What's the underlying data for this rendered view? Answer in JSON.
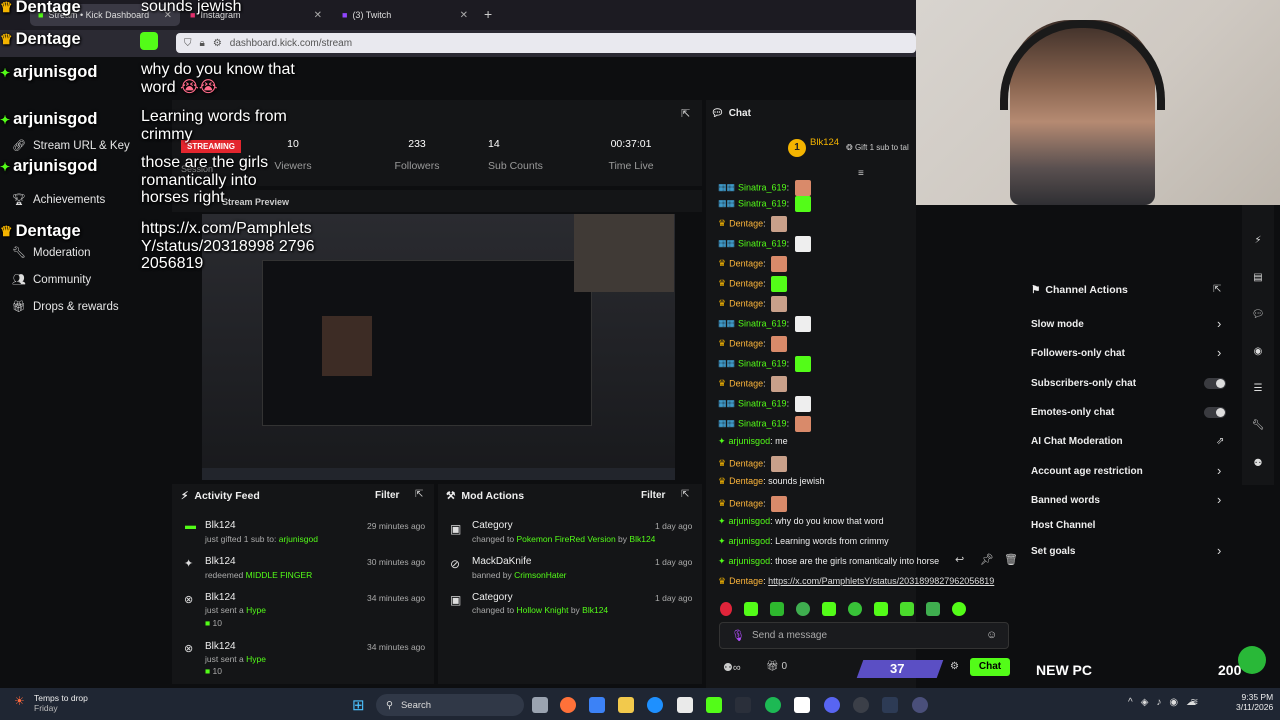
{
  "browser": {
    "tabs": [
      {
        "label": "Stream • Kick Dashboard"
      },
      {
        "label": "Instagram"
      },
      {
        "label": "(3) Twitch"
      }
    ],
    "url": "dashboard.kick.com/stream"
  },
  "sidebar": {
    "items": [
      {
        "label": "Stream URL & Key",
        "icon": "link-icon"
      },
      {
        "label": "Achievements",
        "icon": "trophy-icon"
      },
      {
        "label": "Moderation",
        "icon": "wrench-icon"
      },
      {
        "label": "Community",
        "icon": "people-icon"
      },
      {
        "label": "Drops & rewards",
        "icon": "gift-icon"
      }
    ]
  },
  "stats": {
    "status": "STREAMING",
    "session_label": "Session",
    "viewers": {
      "value": "10",
      "label": "Viewers"
    },
    "followers": {
      "value": "233",
      "label": "Followers"
    },
    "subs": {
      "value": "14",
      "label": "Sub Counts"
    },
    "time": {
      "value": "00:37:01",
      "label": "Time Live"
    }
  },
  "preview": {
    "title": "Stream Preview"
  },
  "activity": {
    "title": "Activity Feed",
    "filter": "Filter",
    "items": [
      {
        "name": "Blk124",
        "text": "just gifted 1 sub to:",
        "highlight": "arjunisgod",
        "time": "29 minutes ago"
      },
      {
        "name": "Blk124",
        "text": "redeemed",
        "highlight": "MIDDLE FINGER",
        "time": "30 minutes ago"
      },
      {
        "name": "Blk124",
        "text": "just sent a",
        "highlight": "Hype",
        "extra": "10",
        "time": "34 minutes ago"
      },
      {
        "name": "Blk124",
        "text": "just sent a",
        "highlight": "Hype",
        "extra": "10",
        "time": "34 minutes ago"
      }
    ]
  },
  "mod": {
    "title": "Mod Actions",
    "filter": "Filter",
    "items": [
      {
        "name": "Category",
        "pre": "changed to",
        "highlight": "Pokemon FireRed Version",
        "by": "by",
        "user": "Blk124",
        "time": "1 day ago"
      },
      {
        "name": "MackDaKnife",
        "pre": "banned by",
        "highlight": "CrimsonHater",
        "by": "",
        "user": "",
        "time": "1 day ago"
      },
      {
        "name": "Category",
        "pre": "changed to",
        "highlight": "Hollow Knight",
        "by": "by",
        "user": "Blk124",
        "time": "1 day ago"
      }
    ]
  },
  "chat": {
    "title": "Chat",
    "pinned_user": "Blk124",
    "pinned_count": "1",
    "gift_text": "Gift 1 sub to tal",
    "messages": [
      {
        "user": "Sinatra_619",
        "text": "",
        "kind": "s"
      },
      {
        "user": "Sinatra_619",
        "text": "",
        "kind": "s"
      },
      {
        "user": "Dentage",
        "text": "",
        "kind": "d"
      },
      {
        "user": "Sinatra_619",
        "text": "",
        "kind": "s"
      },
      {
        "user": "Dentage",
        "text": "",
        "kind": "d"
      },
      {
        "user": "Dentage",
        "text": "",
        "kind": "d"
      },
      {
        "user": "Dentage",
        "text": "",
        "kind": "d"
      },
      {
        "user": "Sinatra_619",
        "text": "",
        "kind": "s"
      },
      {
        "user": "Dentage",
        "text": "",
        "kind": "d"
      },
      {
        "user": "Sinatra_619",
        "text": "",
        "kind": "s"
      },
      {
        "user": "Dentage",
        "text": "",
        "kind": "d"
      },
      {
        "user": "Sinatra_619",
        "text": "",
        "kind": "s"
      },
      {
        "user": "Sinatra_619",
        "text": "",
        "kind": "s"
      },
      {
        "user": "arjunisgod",
        "text": "me",
        "kind": "a"
      },
      {
        "user": "Dentage",
        "text": "",
        "kind": "d"
      },
      {
        "user": "Dentage",
        "text": "sounds jewish",
        "kind": "d"
      },
      {
        "user": "Dentage",
        "text": "",
        "kind": "d"
      },
      {
        "user": "arjunisgod",
        "text": "why do you know that word",
        "kind": "a"
      },
      {
        "user": "arjunisgod",
        "text": "Learning words from crimmy",
        "kind": "a"
      },
      {
        "user": "arjunisgod",
        "text": "those are the girls romantically into horse",
        "kind": "a"
      },
      {
        "user": "Dentage",
        "text": "https://x.com/PamphletsY/status/2031899827962056819",
        "kind": "d"
      }
    ],
    "placeholder": "Send a message",
    "send_label": "Chat",
    "viewer_count": "0"
  },
  "channel_actions": {
    "title": "Channel Actions",
    "items": [
      {
        "label": "Slow mode",
        "control": "chevron"
      },
      {
        "label": "Followers-only chat",
        "control": "chevron"
      },
      {
        "label": "Subscribers-only chat",
        "control": "toggle"
      },
      {
        "label": "Emotes-only chat",
        "control": "toggle"
      },
      {
        "label": "AI Chat Moderation",
        "control": "external"
      },
      {
        "label": "Account age restriction",
        "control": "chevron"
      },
      {
        "label": "Banned words",
        "control": "chevron"
      },
      {
        "label": "Host Channel",
        "control": "none"
      },
      {
        "label": "Set goals",
        "control": "chevron"
      }
    ]
  },
  "overlay": {
    "lines": [
      {
        "user": "Dentage",
        "text": "sounds jewish"
      },
      {
        "user": "Dentage",
        "text": ""
      },
      {
        "user": "arjunisgod",
        "text": "why do you know that word"
      },
      {
        "user": "arjunisgod",
        "text": "Learning words from crimmy"
      },
      {
        "user": "arjunisgod",
        "text": "those are the girls romantically into horses right"
      },
      {
        "user": "Dentage",
        "text": "https://x.com/PamphletsY/status/20318998 27962056819"
      }
    ],
    "goal_count": "37",
    "goal_label": "NEW PC",
    "goal_target": "200"
  },
  "taskbar": {
    "weather": "Temps to drop",
    "weather_day": "Friday",
    "search": "Search",
    "time": "9:35 PM",
    "date": "3/11/2026"
  },
  "colors": {
    "accent": "#53fc18",
    "live": "#e3262e",
    "dentage": "#fcb53b",
    "goal": "#5b4fc4"
  }
}
